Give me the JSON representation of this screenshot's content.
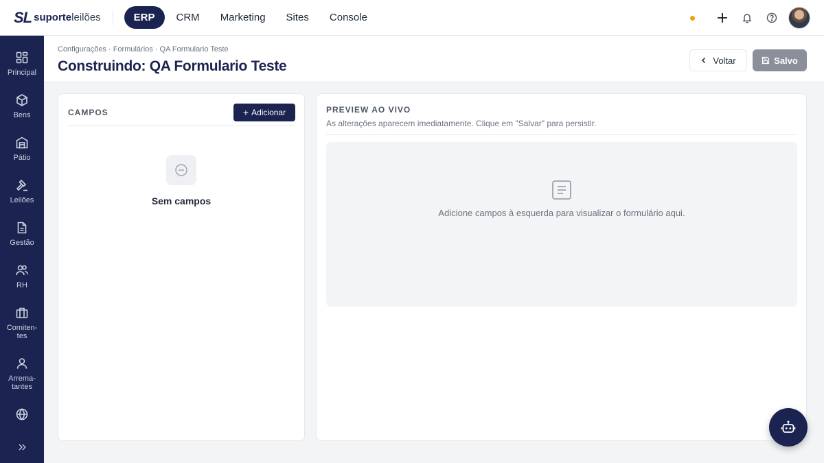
{
  "brand": {
    "mark": "SL",
    "name_bold": "suporte",
    "name_light": "leilões"
  },
  "topnav": {
    "tabs": [
      {
        "label": "ERP",
        "active": true
      },
      {
        "label": "CRM"
      },
      {
        "label": "Marketing"
      },
      {
        "label": "Sites"
      },
      {
        "label": "Console"
      }
    ],
    "status_color": "#f59e0b",
    "icons": [
      "plus-icon",
      "bell-icon",
      "help-icon"
    ]
  },
  "sidebar": {
    "items": [
      {
        "label": "Principal",
        "icon": "dashboard-icon"
      },
      {
        "label": "Bens",
        "icon": "box-icon"
      },
      {
        "label": "Pátio",
        "icon": "warehouse-icon"
      },
      {
        "label": "Leilões",
        "icon": "gavel-icon"
      },
      {
        "label": "Gestão",
        "icon": "document-icon"
      },
      {
        "label": "RH",
        "icon": "users-icon"
      },
      {
        "label": "Comiten-\ntes",
        "icon": "briefcase-icon"
      },
      {
        "label": "Arrema-\ntantes",
        "icon": "user-icon"
      },
      {
        "label": "",
        "icon": "globe-icon"
      }
    ],
    "expand_icon": "chevrons-right-icon"
  },
  "header": {
    "breadcrumb": "Configurações · Formulários · QA Formulario Teste",
    "title": "Construindo: QA Formulario Teste",
    "back_label": "Voltar",
    "save_label": "Salvo"
  },
  "fields_panel": {
    "title": "CAMPOS",
    "add_label": "Adicionar",
    "empty_text": "Sem campos"
  },
  "preview_panel": {
    "title": "PREVIEW AO VIVO",
    "subtitle": "As alterações aparecem imediatamente. Clique em \"Salvar\" para persistir.",
    "empty_message": "Adicione campos à esquerda para visualizar o formulário aqui."
  },
  "colors": {
    "brand": "#1b2351",
    "save_disabled": "#8a8f99"
  }
}
